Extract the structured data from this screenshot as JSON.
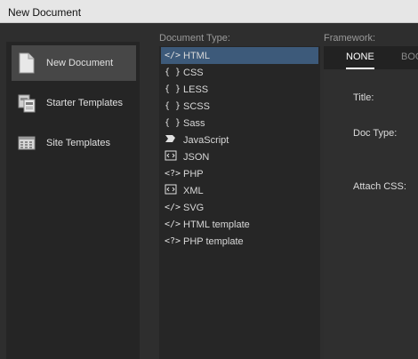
{
  "window": {
    "title": "New Document"
  },
  "categories": [
    {
      "label": "New Document",
      "icon": "document-icon",
      "active": true
    },
    {
      "label": "Starter Templates",
      "icon": "starter-templates-icon",
      "active": false
    },
    {
      "label": "Site Templates",
      "icon": "site-templates-icon",
      "active": false
    }
  ],
  "doc_type": {
    "label": "Document Type:",
    "items": [
      {
        "label": "HTML",
        "glyph": "</>",
        "icon": "code-tag-icon",
        "selected": true
      },
      {
        "label": "CSS",
        "glyph": "{ }",
        "icon": "braces-icon"
      },
      {
        "label": "LESS",
        "glyph": "{ }",
        "icon": "braces-icon"
      },
      {
        "label": "SCSS",
        "glyph": "{ }",
        "icon": "braces-icon"
      },
      {
        "label": "Sass",
        "glyph": "{ }",
        "icon": "braces-icon"
      },
      {
        "label": "JavaScript",
        "glyph": "",
        "icon": "javascript-icon"
      },
      {
        "label": "JSON",
        "glyph": "",
        "icon": "json-icon"
      },
      {
        "label": "PHP",
        "glyph": "<?>",
        "icon": "php-icon"
      },
      {
        "label": "XML",
        "glyph": "",
        "icon": "xml-icon"
      },
      {
        "label": "SVG",
        "glyph": "</>",
        "icon": "code-tag-icon"
      },
      {
        "label": "HTML template",
        "glyph": "</>",
        "icon": "code-tag-icon"
      },
      {
        "label": "PHP template",
        "glyph": "<?>",
        "icon": "php-icon"
      }
    ]
  },
  "framework": {
    "label": "Framework:",
    "tabs": [
      {
        "label": "NONE",
        "active": true
      },
      {
        "label": "BOO",
        "active": false
      }
    ],
    "fields": {
      "title_label": "Title:",
      "doctype_label": "Doc Type:",
      "attach_css_label": "Attach CSS:"
    }
  },
  "colors": {
    "selected_row": "#3d5a7a",
    "active_category": "#474747",
    "background": "#2e2e2e"
  }
}
